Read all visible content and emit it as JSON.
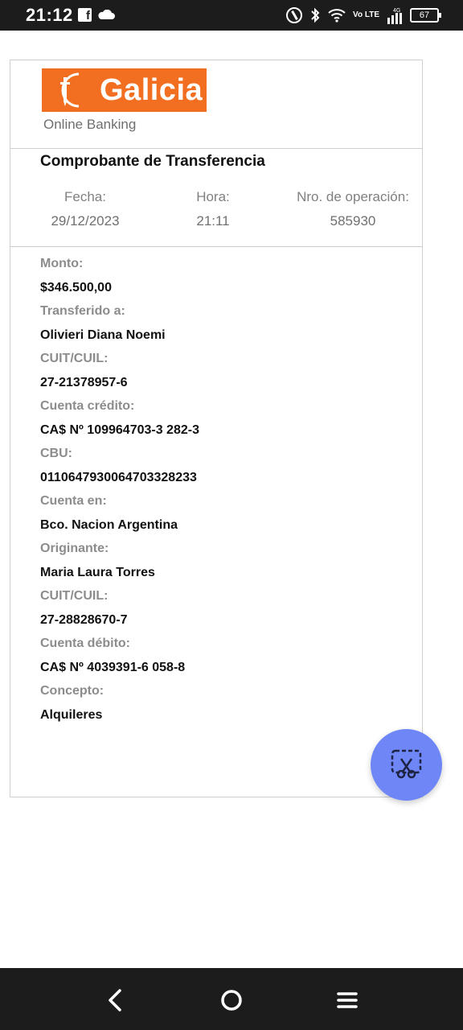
{
  "status_bar": {
    "time": "21:12",
    "network": "Vo LTE",
    "network_gen": "4G",
    "battery": "67",
    "icons": [
      "facebook-icon",
      "cloud-icon",
      "nfc-icon",
      "bluetooth-icon",
      "wifi-icon",
      "signal-icon",
      "battery-icon"
    ]
  },
  "logo": {
    "brand": "Galicia",
    "subtitle": "Online Banking",
    "brand_color": "#f26f21"
  },
  "receipt": {
    "title": "Comprobante de Transferencia",
    "date_label": "Fecha:",
    "date_value": "29/12/2023",
    "time_label": "Hora:",
    "time_value": "21:11",
    "op_label": "Nro. de operación:",
    "op_value": "585930"
  },
  "fields": [
    {
      "label": "Monto:",
      "value": "$346.500,00"
    },
    {
      "label": "Transferido a:",
      "value": "Olivieri Diana Noemi"
    },
    {
      "label": "CUIT/CUIL:",
      "value": "27-21378957-6"
    },
    {
      "label": "Cuenta crédito:",
      "value": "CA$ Nº 109964703-3 282-3"
    },
    {
      "label": "CBU:",
      "value": "0110647930064703328233"
    },
    {
      "label": "Cuenta en:",
      "value": "Bco. Nacion Argentina"
    },
    {
      "label": "Originante:",
      "value": "Maria Laura Torres"
    },
    {
      "label": "CUIT/CUIL:",
      "value": "27-28828670-7"
    },
    {
      "label": "Cuenta débito:",
      "value": "CA$ Nº 4039391-6 058-8"
    },
    {
      "label": "Concepto:",
      "value": "Alquileres"
    }
  ],
  "fab": {
    "icon": "screenshot-scissors-icon",
    "color": "#6f86f7"
  },
  "nav": {
    "icons": [
      "back-icon",
      "home-icon",
      "menu-icon"
    ]
  }
}
